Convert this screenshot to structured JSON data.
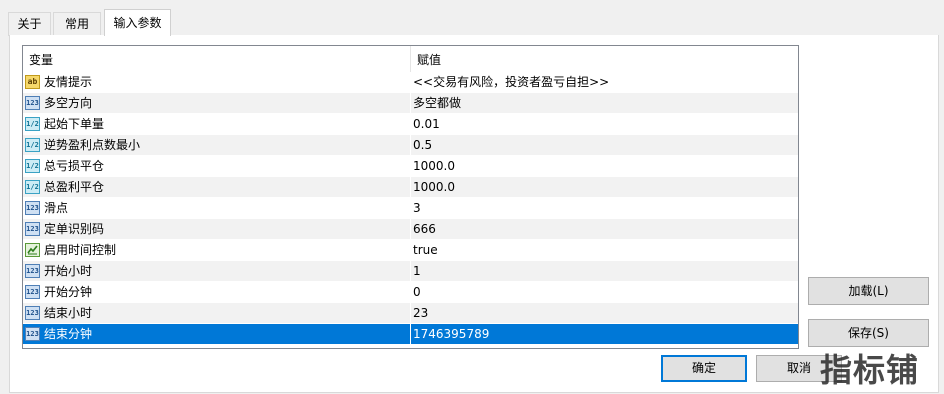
{
  "tabs": [
    {
      "label": "关于"
    },
    {
      "label": "常用"
    },
    {
      "label": "输入参数",
      "active": true
    }
  ],
  "grid": {
    "headers": {
      "name": "变量",
      "value": "赋值"
    },
    "rows": [
      {
        "icon": "text-type-icon",
        "icon_text": "ab",
        "name": "友情提示",
        "value": "<<交易有风险，投资者盈亏自担>>"
      },
      {
        "icon": "integer-type-icon",
        "icon_text": "123",
        "name": "多空方向",
        "value": "多空都做"
      },
      {
        "icon": "double-type-icon",
        "icon_text": "1/2",
        "name": "起始下单量",
        "value": "0.01"
      },
      {
        "icon": "double-type-icon",
        "icon_text": "1/2",
        "name": "逆势盈利点数最小",
        "value": "0.5"
      },
      {
        "icon": "double-type-icon",
        "icon_text": "1/2",
        "name": "总亏损平仓",
        "value": "1000.0"
      },
      {
        "icon": "double-type-icon",
        "icon_text": "1/2",
        "name": "总盈利平仓",
        "value": "1000.0"
      },
      {
        "icon": "integer-type-icon",
        "icon_text": "123",
        "name": "滑点",
        "value": "3"
      },
      {
        "icon": "integer-type-icon",
        "icon_text": "123",
        "name": "定单识别码",
        "value": "666"
      },
      {
        "icon": "bool-type-icon",
        "icon_text": "",
        "name": "启用时间控制",
        "value": "true"
      },
      {
        "icon": "integer-type-icon",
        "icon_text": "123",
        "name": "开始小时",
        "value": "1"
      },
      {
        "icon": "integer-type-icon",
        "icon_text": "123",
        "name": "开始分钟",
        "value": "0"
      },
      {
        "icon": "integer-type-icon",
        "icon_text": "123",
        "name": "结束小时",
        "value": "23"
      },
      {
        "icon": "integer-type-icon",
        "icon_text": "123",
        "name": "结束分钟",
        "value": "1746395789",
        "selected": true
      }
    ]
  },
  "buttons": {
    "load": "加载(L)",
    "save": "保存(S)",
    "ok": "确定",
    "cancel": "取消"
  },
  "watermark": "指标铺",
  "colors": {
    "selection": "#0078d7",
    "alt_row": "#f2f2f2",
    "panel": "#f0f0f0"
  }
}
